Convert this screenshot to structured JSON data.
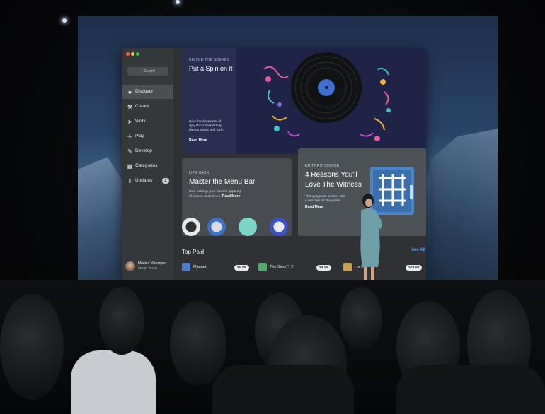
{
  "app": {
    "search_placeholder": "Search",
    "sidebar_items": [
      {
        "label": "Discover",
        "icon": "star-icon",
        "active": true
      },
      {
        "label": "Create",
        "icon": "hammer-icon"
      },
      {
        "label": "Work",
        "icon": "paper-plane-icon"
      },
      {
        "label": "Play",
        "icon": "rocket-icon"
      },
      {
        "label": "Develop",
        "icon": "wrench-icon"
      },
      {
        "label": "Categories",
        "icon": "grid-icon"
      },
      {
        "label": "Updates",
        "icon": "download-icon",
        "badge": "2"
      }
    ],
    "profile": {
      "name": "Monica Velazquez",
      "credit": "$29.87 Credit"
    }
  },
  "hero_card": {
    "kicker": "BEHIND THE SCENES",
    "title": "Put a Spin on It",
    "desc_lines": [
      "How the developer of",
      "djay Pro 2 masterfully",
      "blends music and tech."
    ],
    "more": "Read More"
  },
  "menu_bar_card": {
    "kicker": "LIFE HACK",
    "title": "Master the Menu Bar",
    "desc_lines": [
      "How to keep your favorite apps top",
      "of screen at all times."
    ],
    "more": "Read More"
  },
  "witness_card": {
    "kicker": "EDITORS' CHOICE",
    "title_lines": [
      "4 Reasons You'll",
      "Love The Witness"
    ],
    "desc_lines": [
      "This gorgeous puzzler sets",
      "a new bar for the genre."
    ],
    "more": "Read More"
  },
  "top_paid": {
    "title": "Top Paid",
    "see_all": "See All",
    "items": [
      {
        "name": "Magnet",
        "price": "$0.99",
        "icon_color": "#4a7ec9"
      },
      {
        "name": "The Sims™ 2",
        "price": "$9.99",
        "icon_color": "#59a86e"
      },
      {
        "name": "...e 3",
        "price": "$29.99",
        "icon_color": "#c9a24a"
      }
    ]
  },
  "colors": {
    "accent": "#4aa3ff",
    "hero_bg": "#242948",
    "sidebar_bg": "#35383b"
  }
}
